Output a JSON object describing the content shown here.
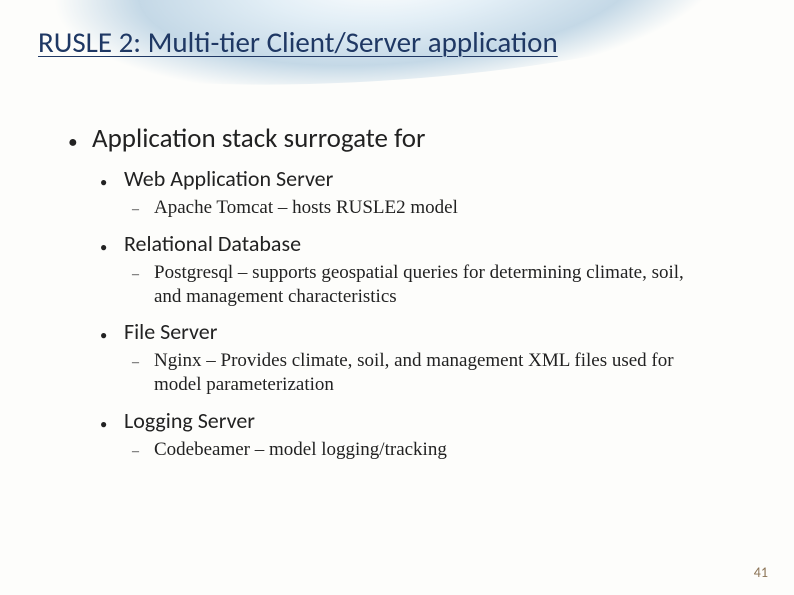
{
  "title": "RUSLE 2: Multi-tier Client/Server application",
  "main": {
    "heading": "Application stack surrogate for",
    "items": [
      {
        "label": "Web Application Server",
        "detail": "Apache Tomcat – hosts RUSLE2 model"
      },
      {
        "label": "Relational Database",
        "detail": "Postgresql – supports geospatial queries for determining climate, soil, and management characteristics"
      },
      {
        "label": "File Server",
        "detail": "Nginx – Provides climate, soil, and management XML files used for model parameterization"
      },
      {
        "label": "Logging Server",
        "detail": "Codebeamer – model logging/tracking"
      }
    ]
  },
  "pageNumber": "41"
}
